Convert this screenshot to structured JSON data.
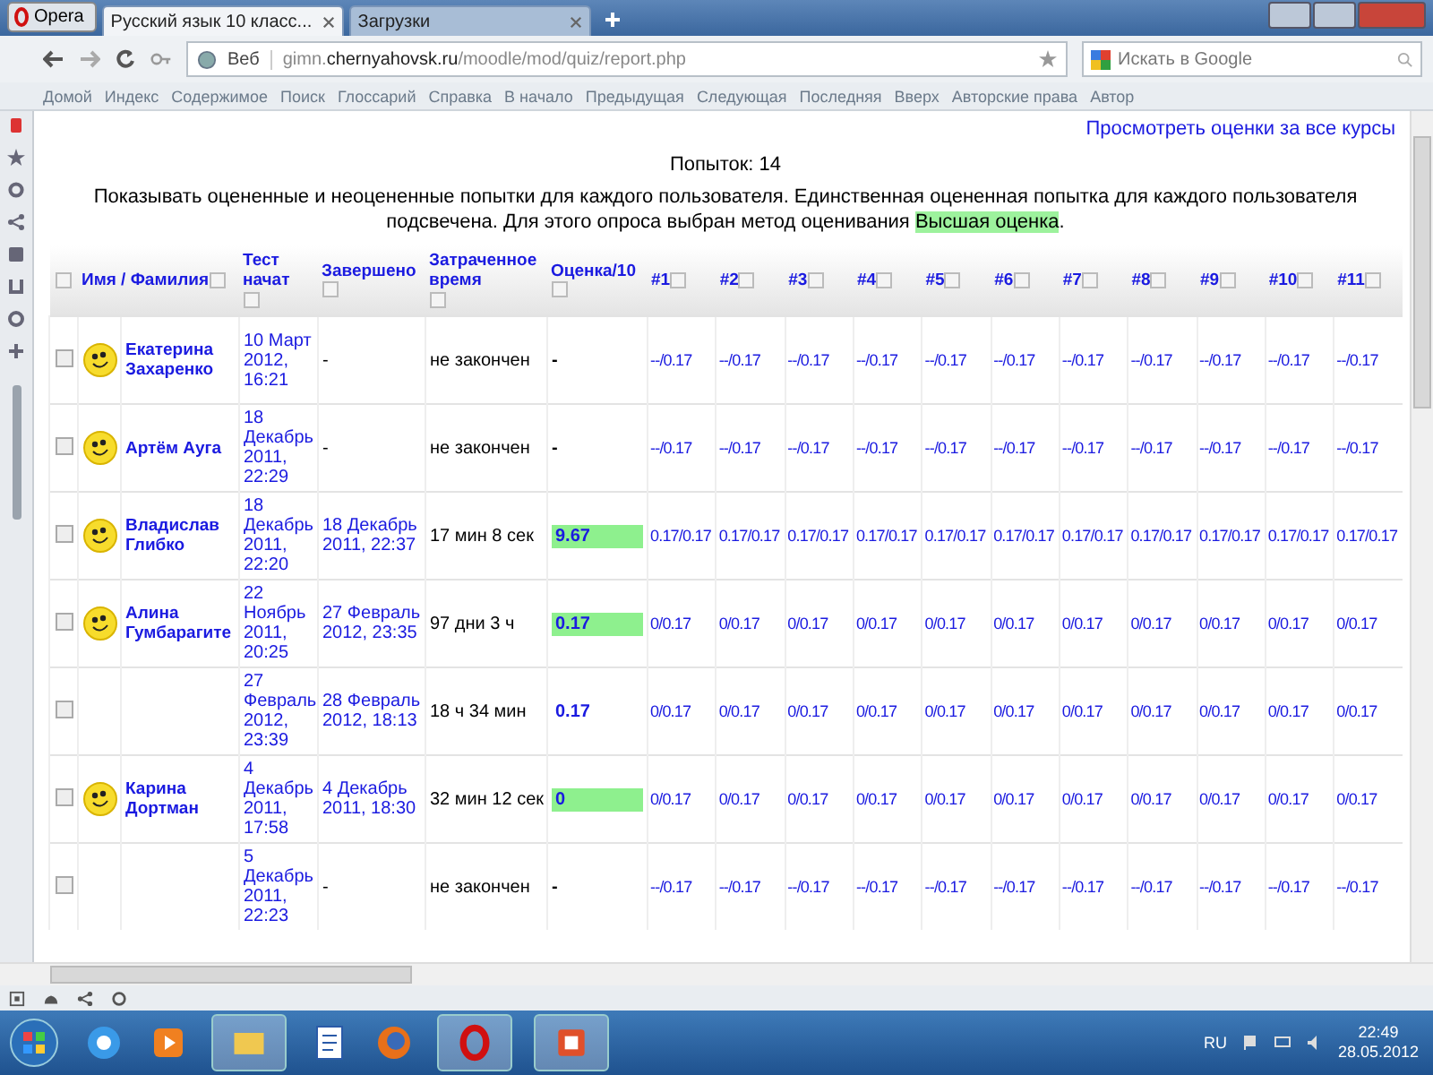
{
  "browser": {
    "menu_button": "Opera",
    "tabs": [
      {
        "label": "Русский язык 10 класс...",
        "selected": true
      },
      {
        "label": "Загрузки",
        "selected": false
      }
    ],
    "address_label": "Веб",
    "url": "gimn.**chernyahovsk.ru**/moodle/mod/quiz/report.php",
    "search_placeholder": "Искать в Google",
    "nav_links": [
      "Домой",
      "Индекс",
      "Содержимое",
      "Поиск",
      "Глоссарий",
      "Справка",
      "В начало",
      "Предыдущая",
      "Следующая",
      "Последняя",
      "Вверх",
      "Авторские права",
      "Автор"
    ]
  },
  "page": {
    "grades_link": "Просмотреть оценки за все курсы",
    "attempts": "Попыток: 14",
    "notice": "Показывать оцененные и неоцененные попытки для каждого пользователя. Единственная оцененная попытка для каждого пользователя подсвечена. Для этого опроса выбран метод оценивания",
    "notice_highlight": "Высшая оценка",
    "notice_end": "."
  },
  "table": {
    "columns": [
      "Имя / Фамилия",
      "Тест начат",
      "Завершено",
      "Затраченное время",
      "Оценка/10",
      "#1",
      "#2",
      "#3",
      "#4",
      "#5",
      "#6",
      "#7",
      "#8",
      "#9",
      "#10",
      "#11"
    ],
    "rows": [
      {
        "checked": false,
        "avatar": true,
        "name": "Екатерина Захаренко",
        "started": "10 Март 2012, 16:21",
        "finished": "-",
        "time": "не закончен",
        "grade": "-",
        "graded": false,
        "scores": [
          "--/0.17",
          "--/0.17",
          "--/0.17",
          "--/0.17",
          "--/0.17",
          "--/0.17",
          "--/0.17",
          "--/0.17",
          "--/0.17",
          "--/0.17",
          "--/0.17"
        ]
      },
      {
        "checked": false,
        "avatar": true,
        "name": "Артём Ауга",
        "started": "18 Декабрь 2011, 22:29",
        "finished": "-",
        "time": "не закончен",
        "grade": "-",
        "graded": false,
        "scores": [
          "--/0.17",
          "--/0.17",
          "--/0.17",
          "--/0.17",
          "--/0.17",
          "--/0.17",
          "--/0.17",
          "--/0.17",
          "--/0.17",
          "--/0.17",
          "--/0.17"
        ]
      },
      {
        "checked": false,
        "avatar": true,
        "name": "Владислав Глибко",
        "started": "18 Декабрь 2011, 22:20",
        "finished": "18 Декабрь 2011, 22:37",
        "time": "17 мин 8 сек",
        "grade": "9.67",
        "graded": true,
        "highlighted": true,
        "scores": [
          "0.17/0.17",
          "0.17/0.17",
          "0.17/0.17",
          "0.17/0.17",
          "0.17/0.17",
          "0.17/0.17",
          "0.17/0.17",
          "0.17/0.17",
          "0.17/0.17",
          "0.17/0.17",
          "0.17/0.17"
        ]
      },
      {
        "checked": false,
        "avatar": true,
        "name": "Алина Гумбарагите",
        "started": "22 Ноябрь 2011, 20:25",
        "finished": "27 Февраль 2012, 23:35",
        "time": "97 дни 3 ч",
        "grade": "0.17",
        "graded": true,
        "highlighted": true,
        "scores": [
          "0/0.17",
          "0/0.17",
          "0/0.17",
          "0/0.17",
          "0/0.17",
          "0/0.17",
          "0/0.17",
          "0/0.17",
          "0/0.17",
          "0/0.17",
          "0/0.17"
        ]
      },
      {
        "checked": false,
        "avatar": false,
        "name": "",
        "started": "27 Февраль 2012, 23:39",
        "finished": "28 Февраль 2012, 18:13",
        "time": "18 ч 34 мин",
        "grade": "0.17",
        "graded": true,
        "highlighted": false,
        "scores": [
          "0/0.17",
          "0/0.17",
          "0/0.17",
          "0/0.17",
          "0/0.17",
          "0/0.17",
          "0/0.17",
          "0/0.17",
          "0/0.17",
          "0/0.17",
          "0/0.17"
        ]
      },
      {
        "checked": false,
        "avatar": true,
        "name": "Карина Дортман",
        "started": "4 Декабрь 2011, 17:58",
        "finished": "4 Декабрь 2011, 18:30",
        "time": "32 мин 12 сек",
        "grade": "0",
        "graded": true,
        "highlighted": true,
        "scores": [
          "0/0.17",
          "0/0.17",
          "0/0.17",
          "0/0.17",
          "0/0.17",
          "0/0.17",
          "0/0.17",
          "0/0.17",
          "0/0.17",
          "0/0.17",
          "0/0.17"
        ]
      },
      {
        "checked": false,
        "avatar": false,
        "name": "",
        "started": "5 Декабрь 2011, 22:23",
        "finished": "-",
        "time": "не закончен",
        "grade": "-",
        "graded": false,
        "scores": [
          "--/0.17",
          "--/0.17",
          "--/0.17",
          "--/0.17",
          "--/0.17",
          "--/0.17",
          "--/0.17",
          "--/0.17",
          "--/0.17",
          "--/0.17",
          "--/0.17"
        ]
      }
    ]
  },
  "taskbar": {
    "language": "RU",
    "time": "22:49",
    "date": "28.05.2012"
  }
}
